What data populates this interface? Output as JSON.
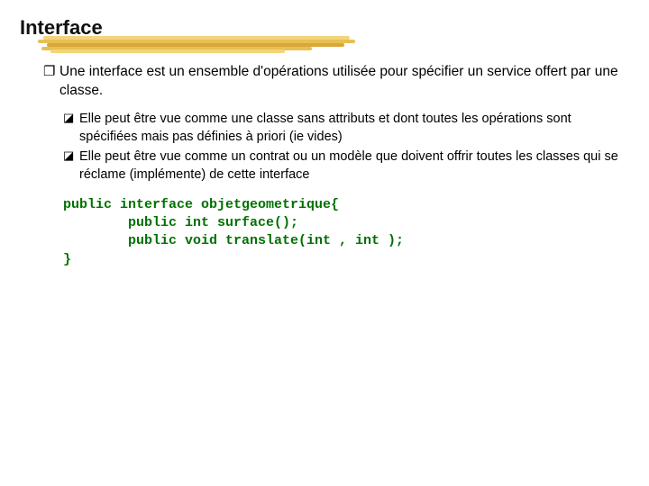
{
  "title": "Interface",
  "bullet_symbol_l1": "❑",
  "bullet_symbol_l2": "⧫",
  "main_bullet": "Une interface est un ensemble d'opérations utilisée pour spécifier un service offert par une classe.",
  "sub_bullets": [
    "Elle peut être vue comme une classe sans attributs et dont toutes les opérations sont spécifiées mais pas définies à priori (ie vides)",
    "Elle peut être vue comme un contrat ou un modèle que doivent offrir toutes les classes qui se réclame (implémente) de cette interface"
  ],
  "code": {
    "l1": "public interface objetgeometrique{",
    "l2": "        public int surface();",
    "l3": "        public void translate(int , int );",
    "l4": "}"
  }
}
